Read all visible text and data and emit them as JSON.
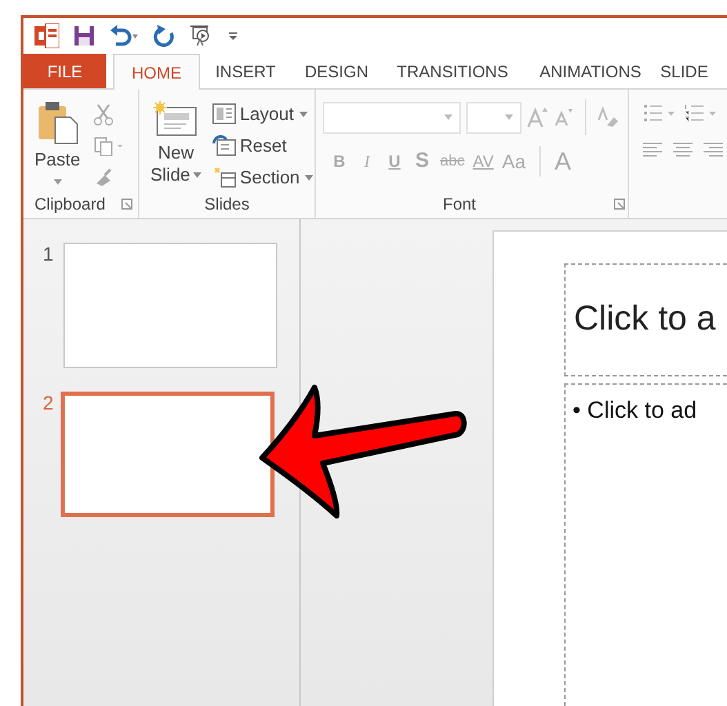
{
  "tabs": [
    {
      "label": "FILE",
      "kind": "file",
      "selected": false
    },
    {
      "label": "HOME",
      "kind": "tab",
      "selected": true
    },
    {
      "label": "INSERT",
      "kind": "tab",
      "selected": false
    },
    {
      "label": "DESIGN",
      "kind": "tab",
      "selected": false
    },
    {
      "label": "TRANSITIONS",
      "kind": "tab",
      "selected": false
    },
    {
      "label": "ANIMATIONS",
      "kind": "tab",
      "selected": false
    },
    {
      "label": "SLIDE",
      "kind": "tab",
      "selected": false
    }
  ],
  "clipboard": {
    "paste": "Paste",
    "label": "Clipboard"
  },
  "slides_group": {
    "new_slide": [
      "New",
      "Slide"
    ],
    "layout": "Layout",
    "reset": "Reset",
    "section": "Section",
    "label": "Slides"
  },
  "font_group": {
    "buttons": [
      "B",
      "I",
      "U",
      "S",
      "abc",
      "AV",
      "Aa"
    ],
    "color_button": "A",
    "label": "Font"
  },
  "slide_thumbnails": [
    {
      "number": "1",
      "selected": false
    },
    {
      "number": "2",
      "selected": true
    }
  ],
  "slide": {
    "title_placeholder": "Click to a",
    "body_placeholder": "• Click to ad"
  }
}
